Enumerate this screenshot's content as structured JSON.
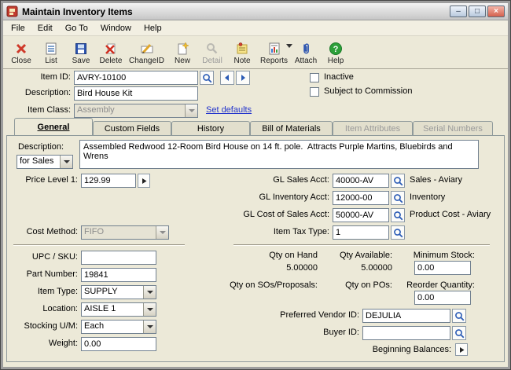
{
  "window": {
    "title": "Maintain Inventory Items",
    "controls": {
      "minimize": "–",
      "maximize": "□",
      "close": "×"
    }
  },
  "menu": {
    "items": [
      "File",
      "Edit",
      "Go To",
      "Window",
      "Help"
    ]
  },
  "toolbar": [
    {
      "label": "Close"
    },
    {
      "label": "List"
    },
    {
      "label": "Save"
    },
    {
      "label": "Delete"
    },
    {
      "label": "ChangeID"
    },
    {
      "label": "New"
    },
    {
      "label": "Detail"
    },
    {
      "label": "Note"
    },
    {
      "label": "Reports"
    },
    {
      "label": "Attach"
    },
    {
      "label": "Help"
    }
  ],
  "header": {
    "item_id": {
      "label": "Item ID:",
      "value": "AVRY-10100"
    },
    "description": {
      "label": "Description:",
      "value": "Bird House Kit"
    },
    "item_class": {
      "label": "Item Class:",
      "value": "Assembly"
    },
    "set_defaults": "Set defaults",
    "inactive_label": "Inactive",
    "commission_label": "Subject to Commission"
  },
  "tabs": [
    {
      "label": "General"
    },
    {
      "label": "Custom Fields"
    },
    {
      "label": "History"
    },
    {
      "label": "Bill of Materials"
    },
    {
      "label": "Item Attributes"
    },
    {
      "label": "Serial Numbers"
    }
  ],
  "general": {
    "description": {
      "label": "Description:",
      "selector": "for Sales",
      "text": "Assembled Redwood 12-Room Bird House on 14 ft. pole.  Attracts Purple Martins, Bluebirds and Wrens"
    },
    "price_level": {
      "label": "Price Level 1:",
      "value": "129.99"
    },
    "cost_method": {
      "label": "Cost Method:",
      "value": "FIFO"
    },
    "gl_sales": {
      "label": "GL Sales Acct:",
      "value": "40000-AV",
      "desc": "Sales - Aviary"
    },
    "gl_inventory": {
      "label": "GL Inventory Acct:",
      "value": "12000-00",
      "desc": "Inventory"
    },
    "gl_cost": {
      "label": "GL Cost of Sales Acct:",
      "value": "50000-AV",
      "desc": "Product Cost - Aviary"
    },
    "item_tax_type": {
      "label": "Item Tax Type:",
      "value": "1"
    },
    "upc_sku": {
      "label": "UPC / SKU:",
      "value": ""
    },
    "part_number": {
      "label": "Part Number:",
      "value": "19841"
    },
    "item_type": {
      "label": "Item Type:",
      "value": "SUPPLY"
    },
    "location": {
      "label": "Location:",
      "value": "AISLE 1"
    },
    "stocking_um": {
      "label": "Stocking U/M:",
      "value": "Each"
    },
    "weight": {
      "label": "Weight:",
      "value": "0.00"
    },
    "qty_on_hand": {
      "label": "Qty on Hand",
      "value": "5.00000"
    },
    "qty_available": {
      "label": "Qty Available:",
      "value": "5.00000"
    },
    "minimum_stock": {
      "label": "Minimum Stock:",
      "value": "0.00"
    },
    "qty_sos": {
      "label": "Qty on SOs/Proposals:",
      "value": ""
    },
    "qty_pos": {
      "label": "Qty on POs:",
      "value": ""
    },
    "reorder_qty": {
      "label": "Reorder Quantity:",
      "value": "0.00"
    },
    "preferred_vendor": {
      "label": "Preferred Vendor ID:",
      "value": "DEJULIA"
    },
    "buyer": {
      "label": "Buyer ID:",
      "value": ""
    },
    "beginning_balances": {
      "label": "Beginning Balances:"
    }
  }
}
